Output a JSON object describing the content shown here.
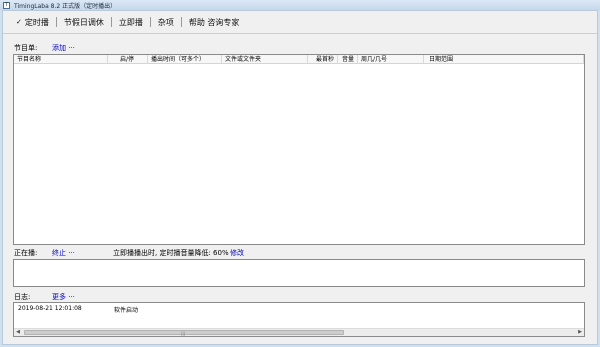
{
  "window": {
    "title": "TimingLaba 8.2 正式版（定时播出）",
    "icon_glyph": "T"
  },
  "menu": [
    {
      "label": "定时播",
      "check": "✓",
      "active": true
    },
    {
      "label": "节假日调休"
    },
    {
      "label": "立即播"
    },
    {
      "label": "杂项"
    },
    {
      "label": "帮助 咨询专家"
    }
  ],
  "program_list": {
    "label": "节目单:",
    "add_link": "添加 ···",
    "columns": [
      "节目名称",
      "启/停",
      "播出时间（可多个）",
      "文件或文件夹",
      "最首秒",
      "音量",
      "周几/几号",
      "日期范围"
    ]
  },
  "now_playing": {
    "label": "正在播:",
    "stop_link": "终止 ···",
    "info": "立即播播出时, 定时播音量降低: 60%",
    "modify_link": "修改"
  },
  "log": {
    "label": "日志:",
    "more_link": "更多 ···",
    "entries": [
      {
        "time": "2019-08-21 12:01:08",
        "message": "软件启动"
      }
    ]
  }
}
